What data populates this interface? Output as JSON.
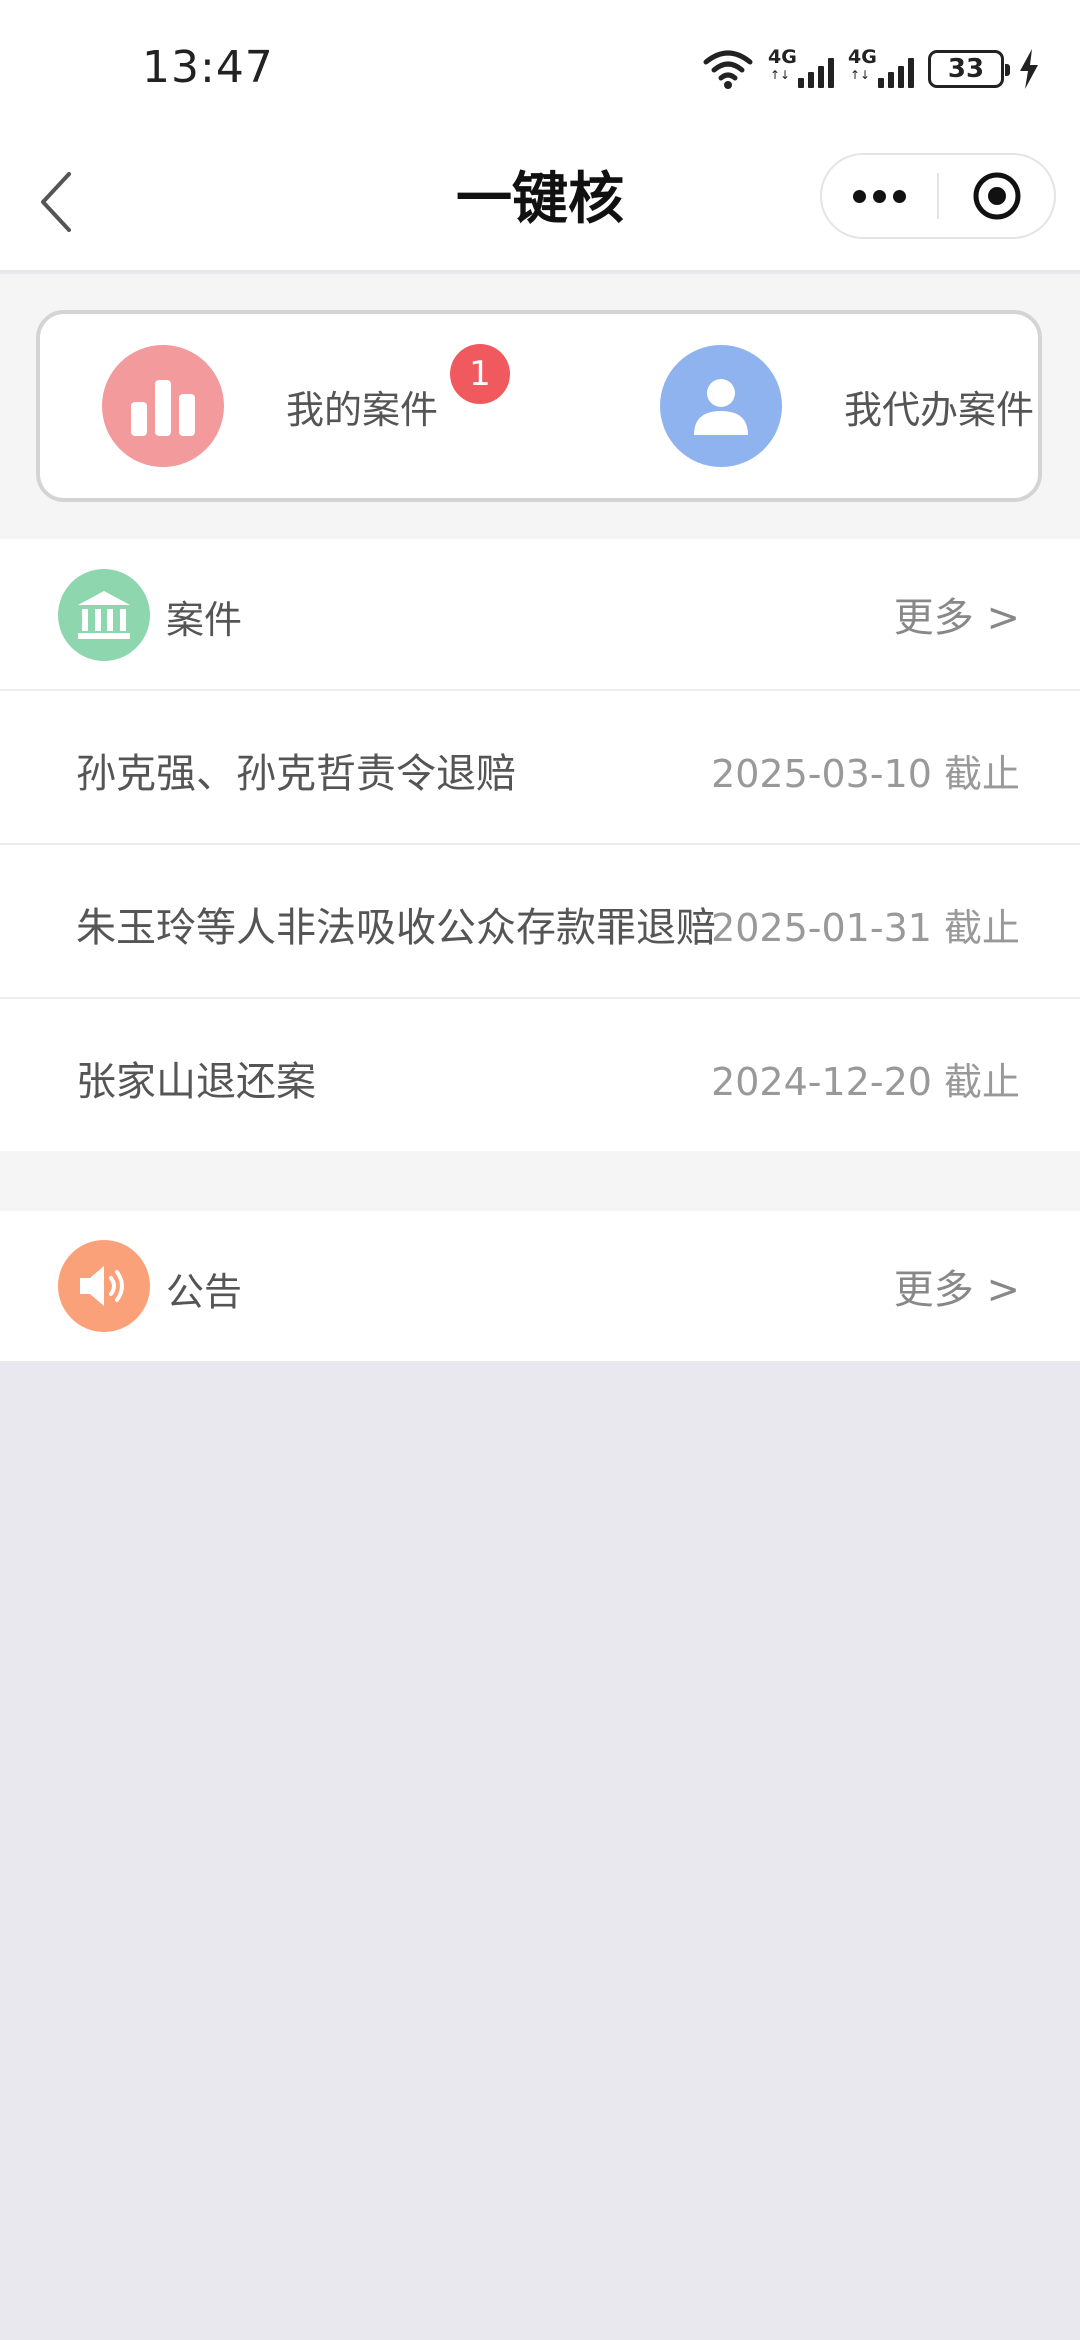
{
  "status_bar": {
    "time": "13:47",
    "network_1": "4G",
    "network_2": "4G",
    "battery": "33"
  },
  "nav": {
    "title": "一键核"
  },
  "quick_actions": [
    {
      "label": "我的案件",
      "badge": "1",
      "icon": "bar-chart-icon",
      "color": "#f29a9c"
    },
    {
      "label": "我代办案件",
      "icon": "user-icon",
      "color": "#8fb3ee"
    }
  ],
  "cases": {
    "title": "案件",
    "more": "更多 >",
    "icon": "bank-icon",
    "items": [
      {
        "name": "孙克强、孙克哲责令退赔",
        "date": "2025-03-10 截止"
      },
      {
        "name": "朱玉玲等人非法吸收公众存款罪退赔",
        "date": "2025-01-31 截止"
      },
      {
        "name": "张家山退还案",
        "date": "2024-12-20 截止"
      }
    ]
  },
  "notices": {
    "title": "公告",
    "more": "更多 >",
    "icon": "speaker-icon"
  },
  "colors": {
    "badge_red": "#f05a5f",
    "bank_green": "#8ed6ad",
    "speaker_orange": "#fba17a"
  }
}
